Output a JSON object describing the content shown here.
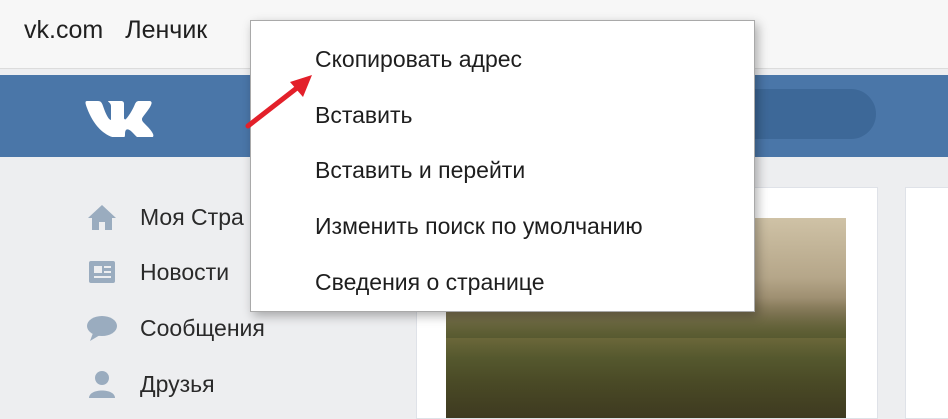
{
  "browser": {
    "url_domain": "vk.com",
    "page_title": "Ленчик"
  },
  "sidebar": {
    "items": [
      {
        "label": "Моя Стра",
        "icon": "home-icon"
      },
      {
        "label": "Новости",
        "icon": "news-icon"
      },
      {
        "label": "Сообщения",
        "icon": "messages-icon"
      },
      {
        "label": "Друзья",
        "icon": "friends-icon"
      }
    ]
  },
  "context_menu": {
    "items": [
      {
        "label": "Скопировать адрес"
      },
      {
        "label": "Вставить"
      },
      {
        "label": "Вставить и перейти"
      },
      {
        "label": "Изменить поиск по умолчанию"
      },
      {
        "label": "Сведения о странице"
      }
    ]
  },
  "colors": {
    "vk_header": "#4a76a8",
    "annotation_arrow": "#e3202a"
  },
  "icons": [
    "vk-logo-icon",
    "home-icon",
    "news-icon",
    "messages-icon",
    "friends-icon",
    "red-arrow-icon"
  ]
}
